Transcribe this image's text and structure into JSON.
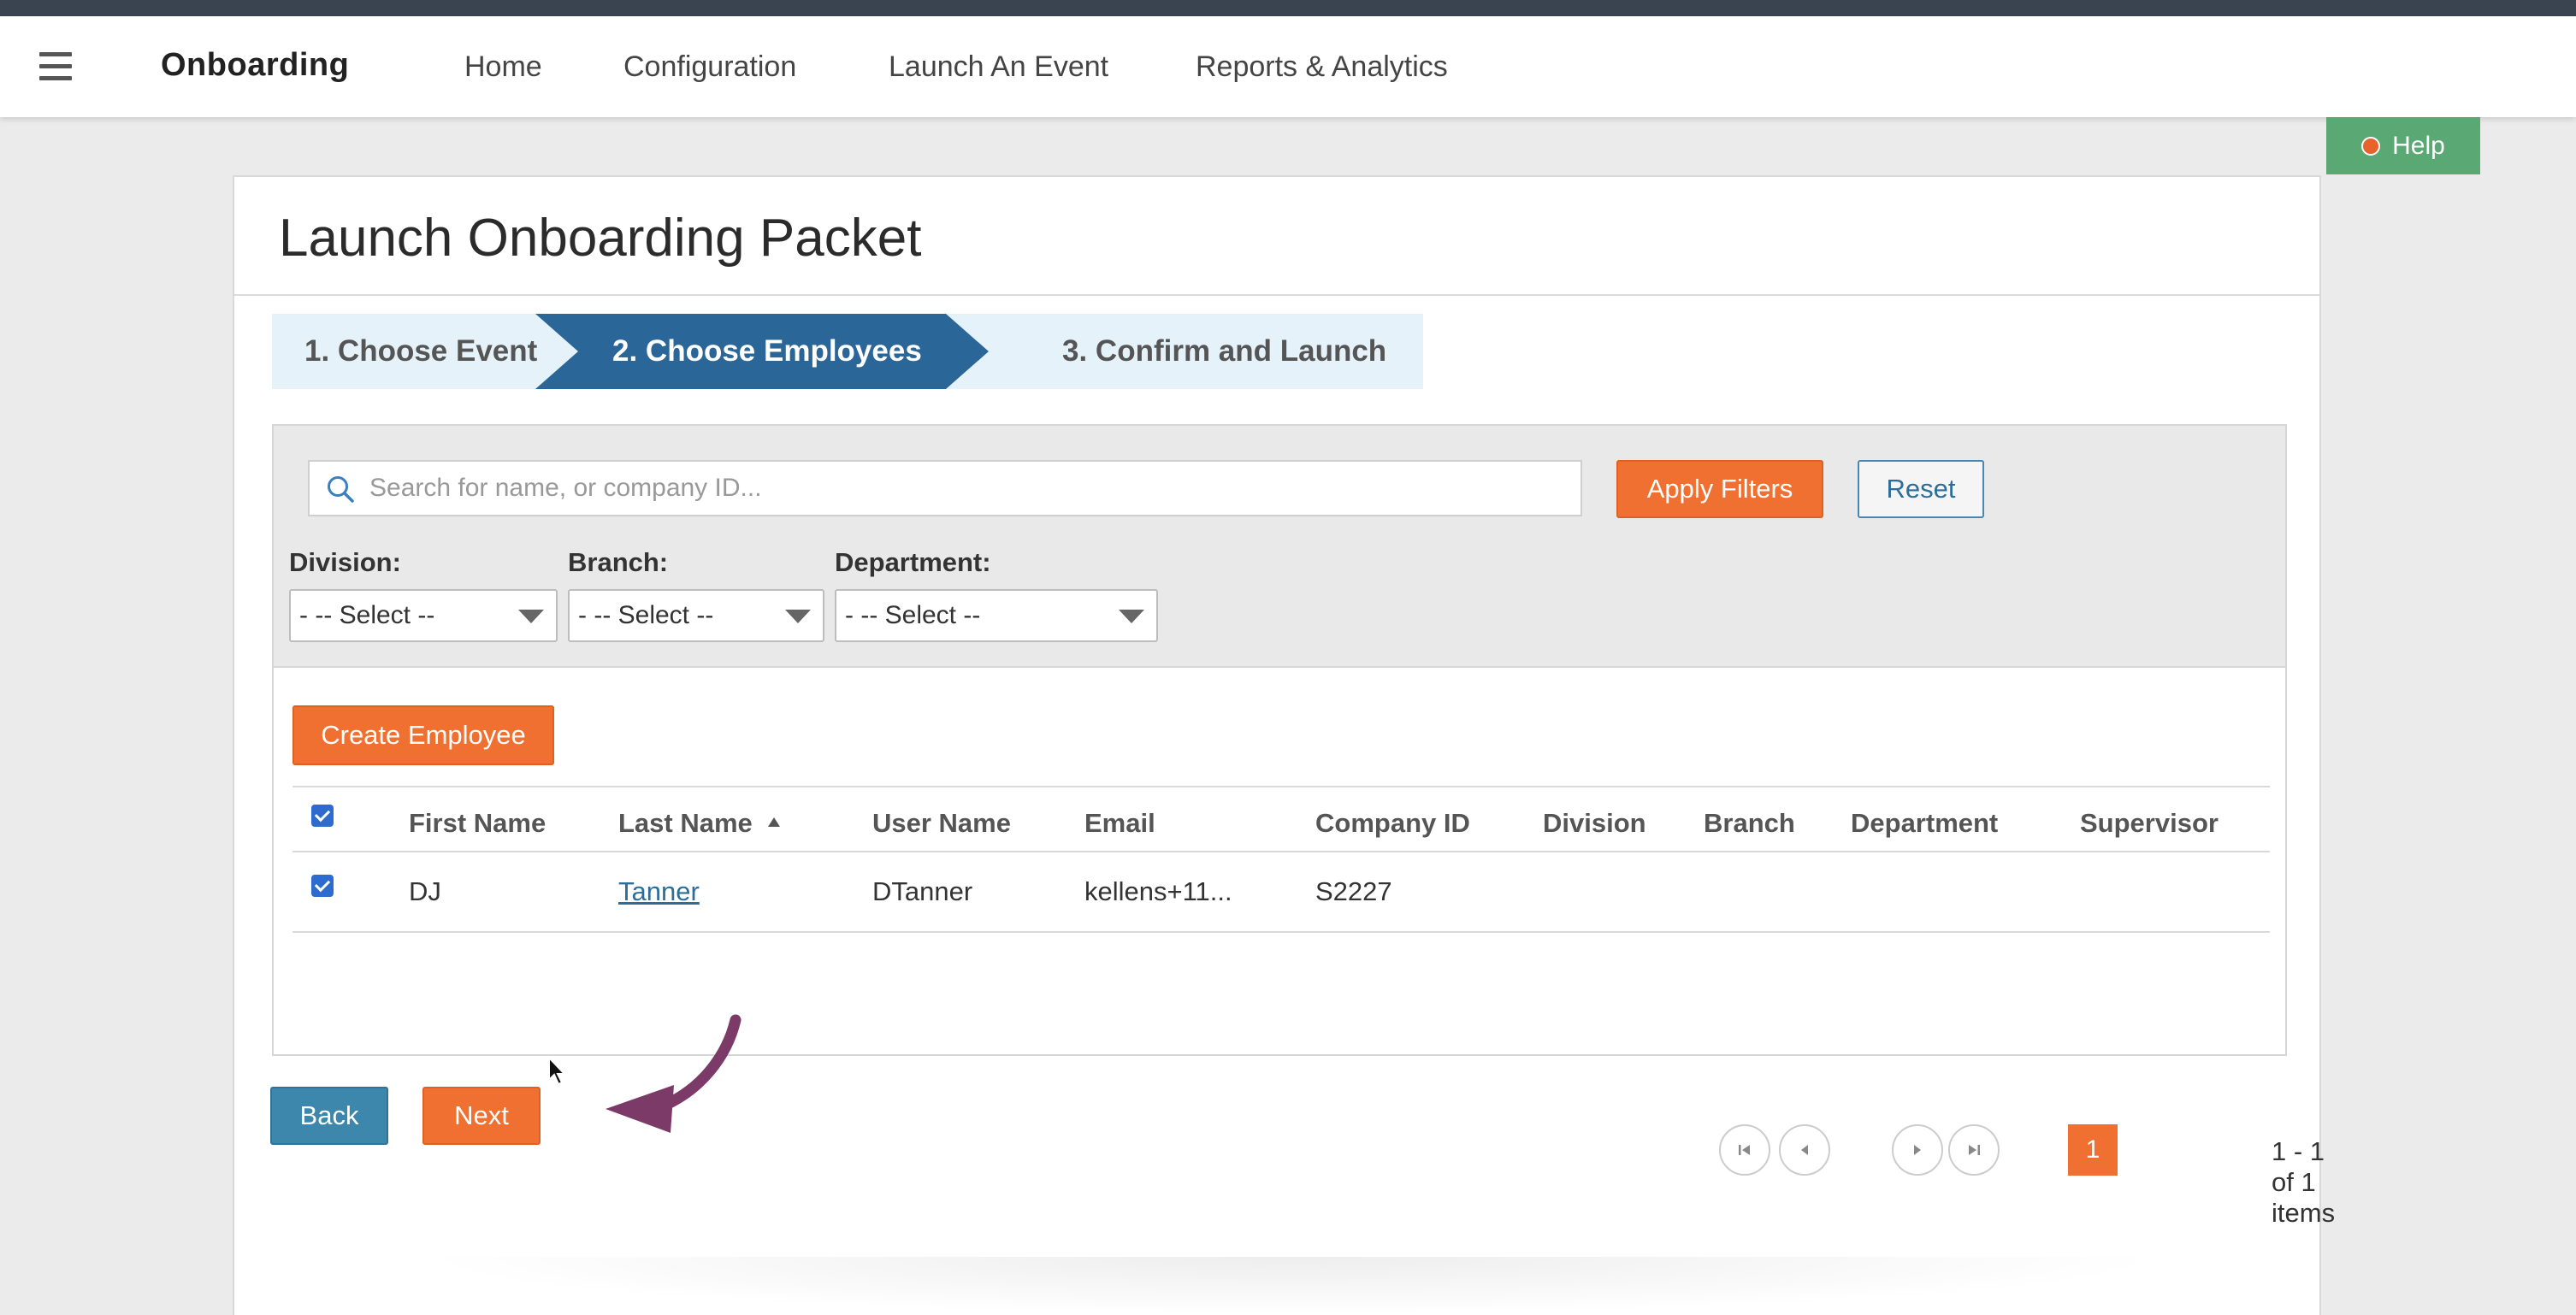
{
  "nav": {
    "brand": "Onboarding",
    "links": [
      "Home",
      "Configuration",
      "Launch An Event",
      "Reports & Analytics"
    ]
  },
  "help": {
    "label": "Help"
  },
  "page": {
    "title": "Launch Onboarding Packet"
  },
  "steps": [
    "1. Choose Event",
    "2. Choose Employees",
    "3. Confirm and Launch"
  ],
  "active_step": 2,
  "filters": {
    "search_placeholder": "Search for name, or company ID...",
    "search_value": "",
    "apply_label": "Apply Filters",
    "reset_label": "Reset",
    "division": {
      "label": "Division:",
      "value": "- -- Select --"
    },
    "branch": {
      "label": "Branch:",
      "value": "- -- Select --"
    },
    "department": {
      "label": "Department:",
      "value": "- -- Select --"
    }
  },
  "table": {
    "create_label": "Create Employee",
    "headers": [
      "First Name",
      "Last Name",
      "User Name",
      "Email",
      "Company ID",
      "Division",
      "Branch",
      "Department",
      "Supervisor"
    ],
    "sorted_column": "Last Name",
    "sort_direction": "ascending",
    "rows": [
      {
        "checked": true,
        "first_name": "DJ",
        "last_name": "Tanner",
        "user_name": "DTanner",
        "email": "kellens+11...",
        "company_id": "S2227",
        "division": "",
        "branch": "",
        "department": "",
        "supervisor": ""
      }
    ]
  },
  "pager": {
    "current_page": "1",
    "info": "1 - 1 of 1 items"
  },
  "actions": {
    "back_label": "Back",
    "next_label": "Next"
  },
  "colors": {
    "orange": "#ef7030",
    "step_active": "#2b6699",
    "help_green": "#5aa874",
    "annotation_arrow": "#7b3a68"
  }
}
